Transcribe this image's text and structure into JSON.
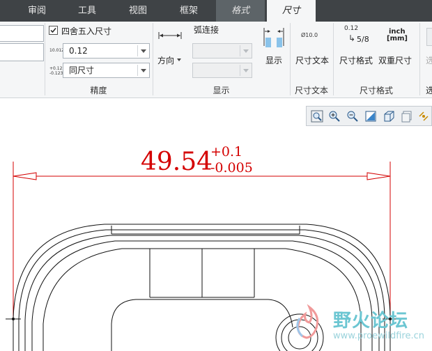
{
  "tabs": {
    "review": "审阅",
    "tools": "工具",
    "view": "视图",
    "frame": "框架",
    "format": "格式",
    "dimension": "尺寸"
  },
  "precision": {
    "round_label": "四舍五入尺寸",
    "round_checked": true,
    "value_icon_text": "10.0123",
    "value": "0.12",
    "tol_icon_text_top": "+0.123",
    "tol_icon_text_bot": "-0.123",
    "tolerance": "同尺寸",
    "group_label": "精度"
  },
  "display": {
    "direction_label": "方向",
    "arc_label": "弧连接",
    "show_label": "显示",
    "group_label": "显示"
  },
  "dim_text": {
    "icon_text": "Ø10.0",
    "button_label": "尺寸文本",
    "group_label": "尺寸文本"
  },
  "dim_format": {
    "icon_top": "0.12",
    "icon_fraction": "5/8",
    "format_label": "尺寸格式",
    "dual_icon_top": "inch",
    "dual_icon_bot": "[mm]",
    "dual_label": "双重尺寸",
    "group_label": "尺寸格式",
    "cut_label": "选"
  },
  "drawing": {
    "nominal": "49.54",
    "upper_tol": "+0.1",
    "lower_tol": "-0.005",
    "dim_color": "#d40000"
  },
  "watermark": {
    "brand": "野火论坛",
    "url": "www.proewildfire.cn"
  },
  "view_toolbar": {
    "icons": [
      "zoom-fit-icon",
      "zoom-in-icon",
      "zoom-out-icon",
      "repaint-icon",
      "shaded-box-icon",
      "saved-views-icon",
      "spin-center-icon"
    ]
  }
}
